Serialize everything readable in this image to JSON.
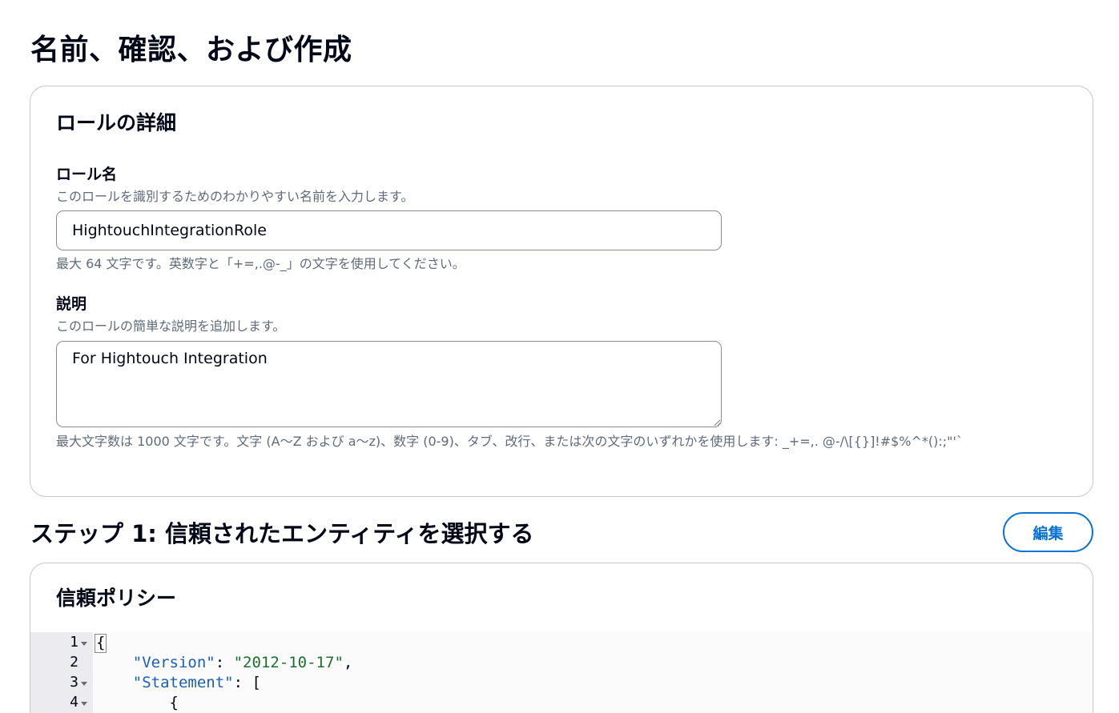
{
  "page_title": "名前、確認、および作成",
  "role_details": {
    "heading": "ロールの詳細",
    "role_name": {
      "label": "ロール名",
      "description": "このロールを識別するためのわかりやすい名前を入力します。",
      "value": "HightouchIntegrationRole",
      "constraint": "最大 64 文字です。英数字と「+=,.@-_」の文字を使用してください。"
    },
    "description": {
      "label": "説明",
      "description": "このロールの簡単な説明を追加します。",
      "value": "For Hightouch Integration",
      "constraint": "最大文字数は 1000 文字です。文字 (A〜Z および a〜z)、数字 (0-9)、タブ、改行、または次の文字のいずれかを使用します: _+=,. @-/\\[{}]!#$%^*():;\"'`"
    }
  },
  "step1": {
    "title": "ステップ 1: 信頼されたエンティティを選択する",
    "edit_label": "編集",
    "trust_policy": {
      "heading": "信頼ポリシー",
      "lines": [
        {
          "number": "1",
          "text": "{"
        },
        {
          "number": "2",
          "key": "\"Version\"",
          "sep": ": ",
          "str": "\"2012-10-17\"",
          "tail": ","
        },
        {
          "number": "3",
          "key": "\"Statement\"",
          "sep": ": ",
          "tail": "["
        },
        {
          "number": "4",
          "text": "{"
        }
      ]
    }
  }
}
